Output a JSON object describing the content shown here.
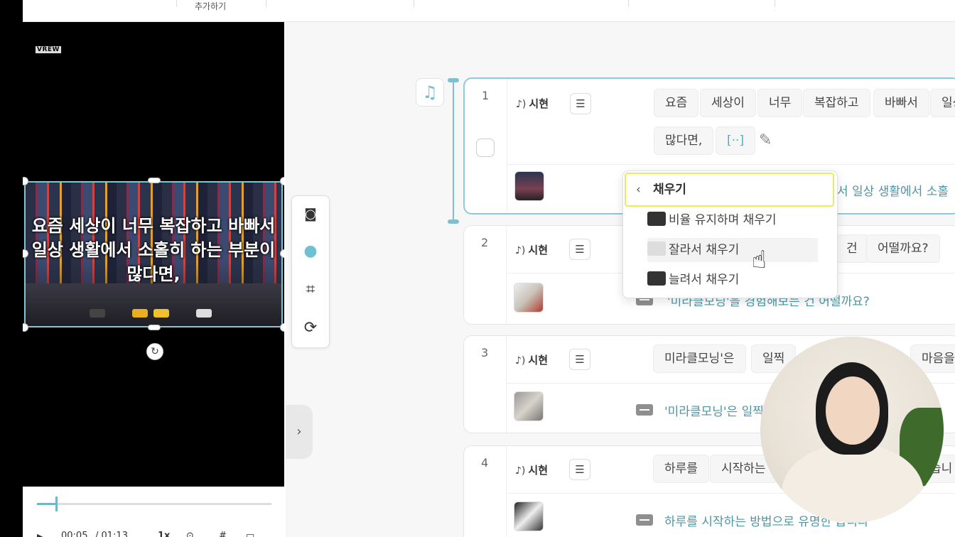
{
  "topbar": {
    "add_label": "추가하기"
  },
  "preview": {
    "logo": "VREW",
    "subtitle": "요즘 세상이 너무 복잡하고 바빠서 일상 생활에서 소홀히 하는 부분이 많다면,"
  },
  "playback": {
    "current_time": "00:05",
    "total_time": "/ 01:13",
    "speed": "1x"
  },
  "tools": {
    "expand_icon": "›"
  },
  "clips": [
    {
      "number": "1",
      "speaker": "시현",
      "words": [
        "요즘",
        "세상이",
        "너무",
        "복잡하고",
        "바빠서",
        "일상"
      ],
      "words2": [
        "많다면,",
        "[··]"
      ],
      "subtitle": "서 일상 생활에서 소홀"
    },
    {
      "number": "2",
      "speaker": "시현",
      "words": [
        "건",
        "어떨까요?"
      ],
      "subtitle": "'미라클모닝'을 경험해보는 건 어떨까요?"
    },
    {
      "number": "3",
      "speaker": "시현",
      "words": [
        "미라클모닝'은",
        "일찍",
        "마음을"
      ],
      "subtitle": "'미라클모닝'은 일찍"
    },
    {
      "number": "4",
      "speaker": "시현",
      "words": [
        "하루를",
        "시작하는",
        "습니"
      ],
      "subtitle": "하루를 시작하는 방법으로 유명한 습니다"
    }
  ],
  "fill_menu": {
    "title": "채우기",
    "items": [
      "비율 유지하며 채우기",
      "잘라서 채우기",
      "늘려서 채우기"
    ]
  },
  "colors": {
    "accent": "#7fc0d0",
    "subtitle_text": "#4d95a6",
    "highlight": "#eaea60"
  }
}
